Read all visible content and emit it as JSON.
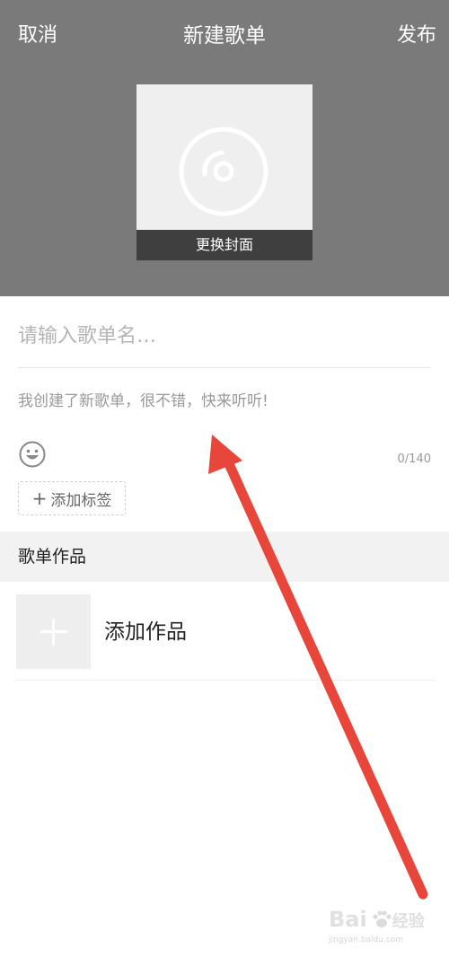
{
  "header": {
    "cancel_label": "取消",
    "title": "新建歌单",
    "publish_label": "发布",
    "cover": {
      "change_label": "更换封面",
      "icon": "disc-icon"
    }
  },
  "form": {
    "name_placeholder": "请输入歌单名…",
    "description_placeholder": "我创建了新歌单，很不错，快来听听!",
    "emoji_icon": "smiley-icon",
    "char_counter": "0/140",
    "add_tag_label": "添加标签"
  },
  "works_section": {
    "title": "歌单作品",
    "add_label": "添加作品"
  },
  "annotation": {
    "arrow_color": "#e8463a"
  },
  "watermark": {
    "text": "Bai",
    "text2": "经验",
    "subtext": "jingyan.baidu.com"
  },
  "colors": {
    "header_bg": "#7a7a7a",
    "cover_bg": "#efefef",
    "section_bg": "#f2f2f2"
  }
}
